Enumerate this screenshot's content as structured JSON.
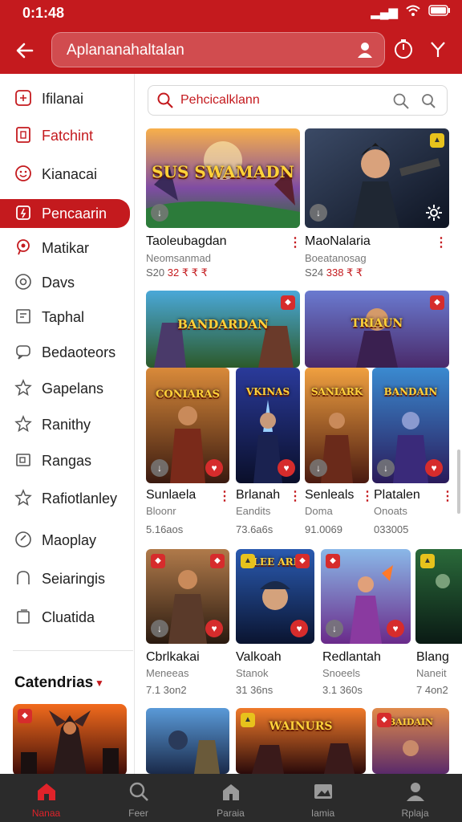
{
  "status": {
    "time": "0:1:48",
    "signal": "▮▮▮",
    "wifi": "wifi",
    "battery": "battery"
  },
  "appbar": {
    "search_text": "Aplananahaltalan",
    "back_icon": "back-arrow-icon"
  },
  "sidebar": {
    "items": [
      {
        "label": "Ifilanai",
        "icon": "tag-icon"
      },
      {
        "label": "Fatchint",
        "icon": "square-icon"
      },
      {
        "label": "Kianacai",
        "icon": "face-icon"
      },
      {
        "label": "Pencaarin",
        "icon": "bolt-icon"
      },
      {
        "label": "Matikar",
        "icon": "pin-icon"
      },
      {
        "label": "Davs",
        "icon": "at-icon"
      },
      {
        "label": "Taphal",
        "icon": "doc-icon"
      },
      {
        "label": "Bedaoteors",
        "icon": "chat-icon"
      },
      {
        "label": "Gapelans",
        "icon": "star-icon"
      },
      {
        "label": "Ranithy",
        "icon": "star2-icon"
      },
      {
        "label": "Rangas",
        "icon": "box-icon"
      },
      {
        "label": "Rafiotlanley",
        "icon": "star3-icon"
      },
      {
        "label": "Maoplay",
        "icon": "check-icon"
      },
      {
        "label": "Seiaringis",
        "icon": "bell-icon"
      },
      {
        "label": "Cluatida",
        "icon": "file-icon"
      }
    ],
    "categories_title": "Catendrias"
  },
  "main_search": {
    "placeholder": "Pehcicalklann"
  },
  "row1": [
    {
      "title": "Taoleubagdan",
      "sub": "Neomsanmad",
      "price_a": "S20 ",
      "price_b": "32 ₹ ₹ ₹",
      "thumb_text": "SUS SWAMADN"
    },
    {
      "title": "MaoNalaria",
      "sub": "Boeatanosag",
      "price_a": "S24 ",
      "price_b": "338 ₹ ₹",
      "thumb_text": ""
    }
  ],
  "row2_banners": [
    {
      "thumb_text": "BANDARDAN"
    },
    {
      "thumb_text": "TRIAUN"
    }
  ],
  "row2": [
    {
      "title": "Sunlaela",
      "sub": "Bloonr",
      "price": "5.16aos",
      "thumb_text": "CONIARAS"
    },
    {
      "title": "Brlanah",
      "sub": "Eandits",
      "price": "73.6a6s",
      "thumb_text": "VKINAS"
    },
    {
      "title": "Senleals",
      "sub": "Doma",
      "price": "91.0069",
      "thumb_text": "SANIARK"
    },
    {
      "title": "Platalen",
      "sub": "Onoats",
      "price": "033005",
      "thumb_text": "BANDAIN"
    }
  ],
  "row3": [
    {
      "title": "Cbrlkakai",
      "sub": "Meneeas",
      "price": "7.1 3on2",
      "thumb_text": ""
    },
    {
      "title": "Valkoah",
      "sub": "Stanok",
      "price": "31 36ns",
      "thumb_text": "ALEE ARIS"
    },
    {
      "title": "Redlantah",
      "sub": "Snoeels",
      "price": "3.1 360s",
      "thumb_text": ""
    },
    {
      "title": "Blang",
      "sub": "Naneit",
      "price": "7 4on2",
      "thumb_text": ""
    }
  ],
  "row4": [
    {
      "thumb_text": ""
    },
    {
      "thumb_text": "WAINURS"
    },
    {
      "thumb_text": "BAIDAIN"
    }
  ],
  "bottom_nav": [
    {
      "label": "Nanaa",
      "icon": "home-icon"
    },
    {
      "label": "Feer",
      "icon": "search-icon"
    },
    {
      "label": "Paraia",
      "icon": "house-icon"
    },
    {
      "label": "Iamia",
      "icon": "image-icon"
    },
    {
      "label": "Rplaja",
      "icon": "person-icon"
    }
  ],
  "colors": {
    "brand": "#c41a1e",
    "nav_bg": "#2b2b2b"
  }
}
